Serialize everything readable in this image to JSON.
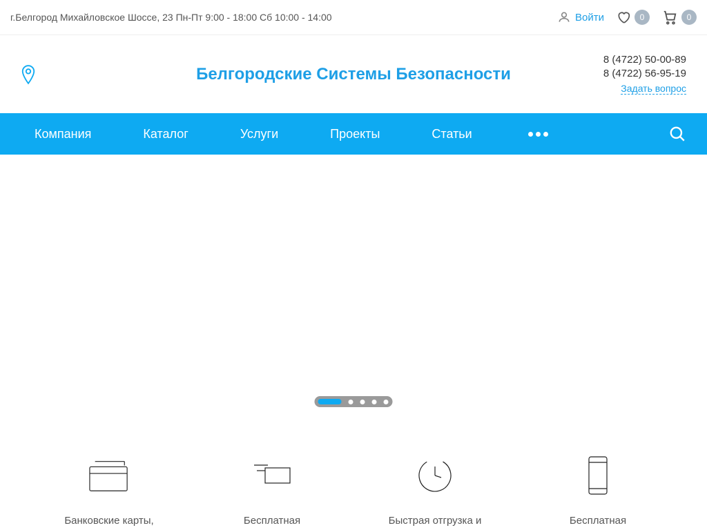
{
  "topbar": {
    "address": "г.Белгород Михайловское Шоссе, 23 Пн-Пт 9:00 - 18:00 Сб 10:00 - 14:00",
    "login_label": "Войти",
    "wishlist_count": "0",
    "cart_count": "0"
  },
  "header": {
    "logo": "Белгородские Системы Безопасности",
    "phone1": "8 (4722) 50-00-89",
    "phone2": "8 (4722) 56-95-19",
    "ask_label": "Задать вопрос"
  },
  "nav": {
    "items": [
      "Компания",
      "Каталог",
      "Услуги",
      "Проекты",
      "Статьи"
    ]
  },
  "features": {
    "items": [
      "Банковские карты,",
      "Бесплатная",
      "Быстрая отгрузка и",
      "Бесплатная"
    ]
  },
  "colors": {
    "accent": "#0eaaf2",
    "link": "#1e9fe6",
    "badge": "#a9b7c4"
  }
}
